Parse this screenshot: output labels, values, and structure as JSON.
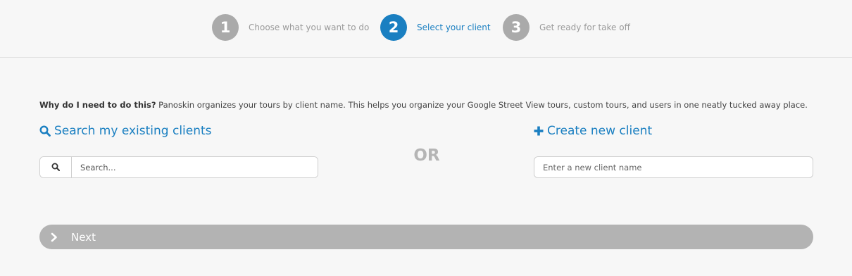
{
  "stepper": {
    "steps": [
      {
        "number": "1",
        "label": "Choose what you want to do",
        "state": "inactive"
      },
      {
        "number": "2",
        "label": "Select your client",
        "state": "active"
      },
      {
        "number": "3",
        "label": "Get ready for take off",
        "state": "inactive"
      }
    ]
  },
  "info": {
    "question": "Why do I need to do this?",
    "explanation": " Panoskin organizes your tours by client name. This helps you organize your Google Street View tours, custom tours, and users in one neatly tucked away place."
  },
  "search": {
    "title": "Search my existing clients",
    "icon": "search-icon",
    "placeholder": "Search...",
    "value": ""
  },
  "divider": {
    "label": "OR"
  },
  "create": {
    "title": "Create new client",
    "icon": "plus-icon",
    "placeholder": "Enter a new client name",
    "value": ""
  },
  "next": {
    "label": "Next",
    "icon": "chevron-right-icon"
  },
  "colors": {
    "accent": "#1a7fc1",
    "inactive_step": "#aaaaaa",
    "next_bar": "#b3b3b3",
    "background": "#f7f7f7"
  }
}
